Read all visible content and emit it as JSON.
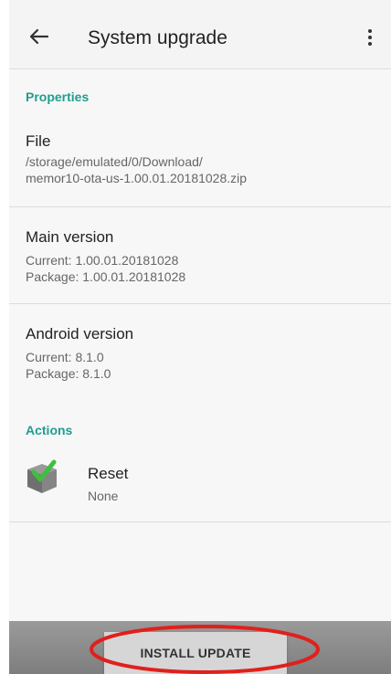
{
  "app_bar": {
    "title": "System upgrade",
    "back_icon": "arrow-left-icon",
    "menu_icon": "more-vert-icon"
  },
  "properties": {
    "header": "Properties",
    "file": {
      "title": "File",
      "line1": "/storage/emulated/0/Download/",
      "line2": "memor10-ota-us-1.00.01.20181028.zip"
    },
    "main_version": {
      "title": "Main version",
      "current": "Current: 1.00.01.20181028",
      "package": "Package: 1.00.01.20181028"
    },
    "android_version": {
      "title": "Android version",
      "current": "Current: 8.1.0",
      "package": "Package: 8.1.0"
    }
  },
  "actions": {
    "header": "Actions",
    "reset": {
      "title": "Reset",
      "value": "None",
      "icon": "checked-box-icon"
    }
  },
  "install_button": {
    "label": "INSTALL UPDATE"
  },
  "colors": {
    "accent": "#1e9e8e",
    "highlight": "#e0201c",
    "bottom_bar": "#8a8a8a"
  }
}
